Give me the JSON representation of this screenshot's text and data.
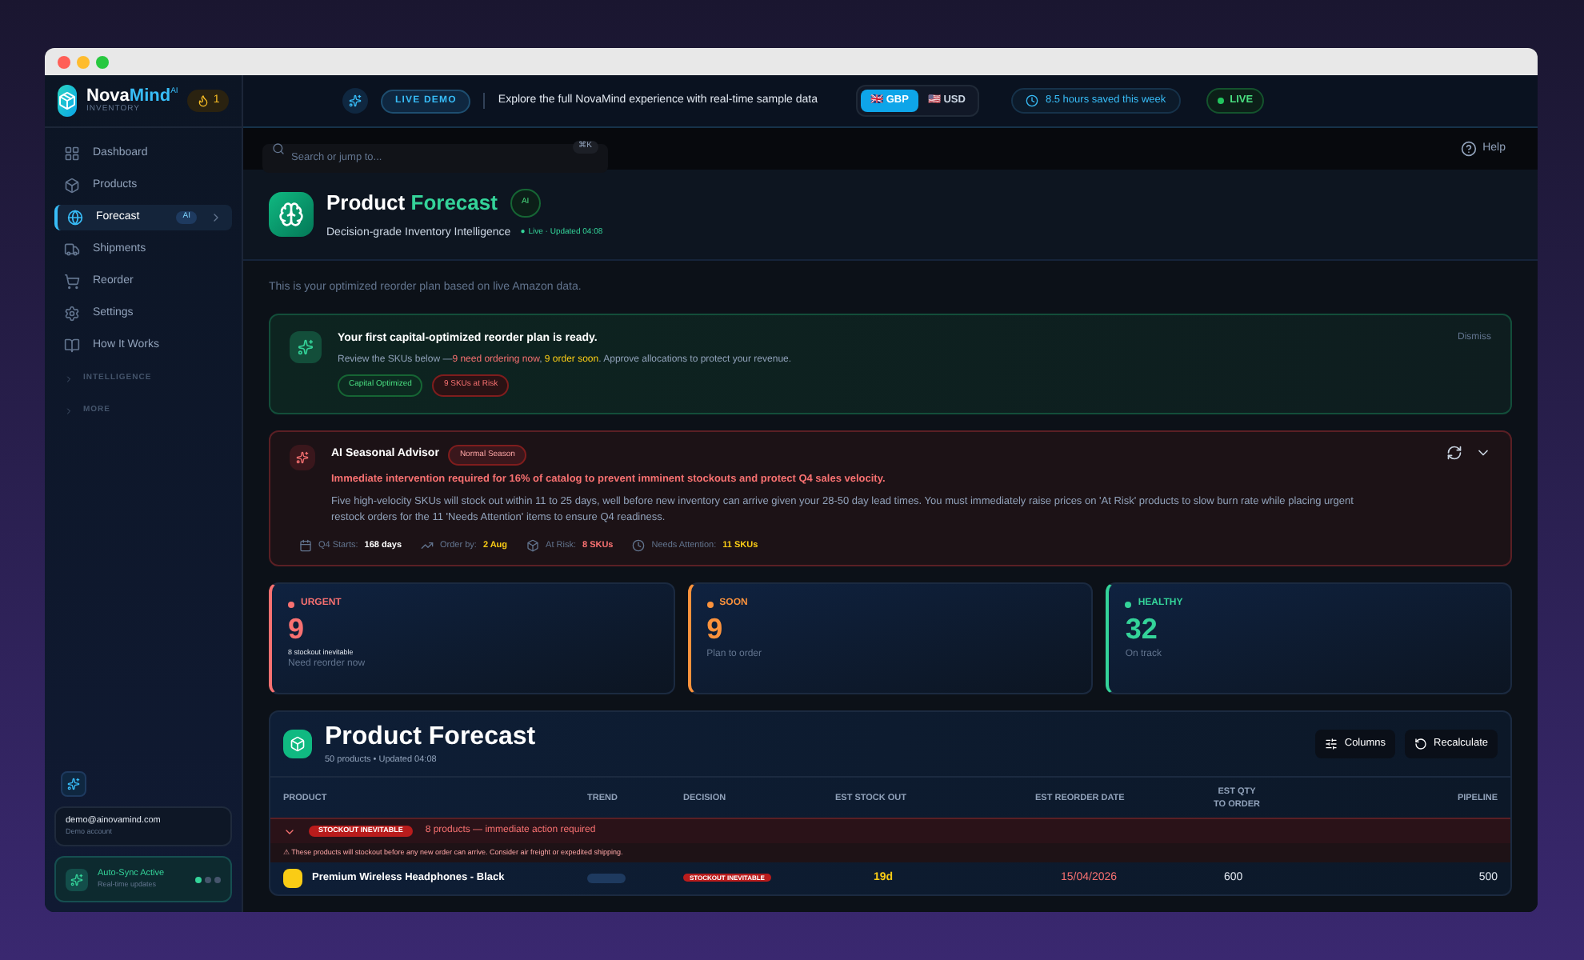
{
  "brand": {
    "name_a": "Nova",
    "name_b": "Mind",
    "sup": "AI",
    "sub": "INVENTORY",
    "streak": "1"
  },
  "sidebar": {
    "items": [
      {
        "label": "Dashboard",
        "selected": false
      },
      {
        "label": "Products",
        "selected": false
      },
      {
        "label": "Forecast",
        "selected": true,
        "badge": "AI"
      },
      {
        "label": "Shipments",
        "selected": false
      },
      {
        "label": "Reorder",
        "selected": false
      },
      {
        "label": "Settings",
        "selected": false
      },
      {
        "label": "How It Works",
        "selected": false
      }
    ],
    "sections": [
      {
        "label": "INTELLIGENCE",
        "expanded": false
      },
      {
        "label": "MORE",
        "expanded": false
      }
    ],
    "account": {
      "email": "demo@ainovamind.com",
      "role": "Demo account"
    },
    "sync": {
      "title": "Auto-Sync Active",
      "subtitle": "Real-time updates"
    }
  },
  "banner": {
    "badge": "LIVE DEMO",
    "text": "Explore the full NovaMind experience with real-time sample data",
    "currencies": [
      {
        "flag": "🇬🇧",
        "code": "GBP",
        "selected": true
      },
      {
        "flag": "🇺🇸",
        "code": "USD",
        "selected": false
      }
    ],
    "saved": "8.5 hours saved this week",
    "live": "LIVE"
  },
  "search": {
    "placeholder": "Search or jump to...",
    "shortcut": "⌘K",
    "help": "Help"
  },
  "header": {
    "title_a": "Product",
    "title_b": "Forecast",
    "ai_badge": "AI",
    "subtitle": "Decision-grade Inventory Intelligence",
    "status_dot": "●",
    "status": "Live · Updated 04:08"
  },
  "intro": "This is your optimized reorder plan based on live Amazon data.",
  "plan_card": {
    "title": "Your first capital-optimized reorder plan is ready.",
    "part_a": "Review the SKUs below —",
    "part_b": "9 need ordering now",
    "part_c": ", ",
    "part_d": "9 order soon",
    "part_e": ". Approve allocations to protect your revenue.",
    "tags": [
      "Capital Optimized",
      "9 SKUs at Risk"
    ],
    "dismiss": "Dismiss"
  },
  "advisor": {
    "title": "AI Seasonal Advisor",
    "season": "Normal Season",
    "headline": "Immediate intervention required for 16% of catalog to prevent imminent stockouts and protect Q4 sales velocity.",
    "body": "Five high-velocity SKUs will stock out within 11 to 25 days, well before new inventory can arrive given your 28-50 day lead times. You must immediately raise prices on 'At Risk' products to slow burn rate while placing urgent restock orders for the 11 'Needs Attention' items to ensure Q4 readiness.",
    "expanded": true,
    "facts": [
      {
        "label": "Q4 Starts:",
        "value": "168 days",
        "color": "#ffffff"
      },
      {
        "label": "Order by:",
        "value": "2 Aug",
        "color": "#facc15"
      },
      {
        "label": "At Risk:",
        "value": "8 SKUs",
        "color": "#f87171"
      },
      {
        "label": "Needs Attention:",
        "value": "11 SKUs",
        "color": "#facc15"
      }
    ]
  },
  "stats": [
    {
      "label": "URGENT",
      "value": "9",
      "note": "8 stockout inevitable",
      "caption": "Need reorder now",
      "color": "#f87171"
    },
    {
      "label": "SOON",
      "value": "9",
      "caption": "Plan to order",
      "color": "#fb923c"
    },
    {
      "label": "HEALTHY",
      "value": "32",
      "caption": "On track",
      "color": "#34d399"
    }
  ],
  "table": {
    "title": "Product Forecast",
    "meta": "50 products • Updated 04:08",
    "buttons": [
      "Columns",
      "Recalculate"
    ],
    "columns": [
      "PRODUCT",
      "TREND",
      "DECISION",
      "EST STOCK OUT",
      "EST REORDER DATE",
      "EST QTY TO ORDER",
      "PIPELINE"
    ],
    "group": {
      "badge": "STOCKOUT INEVITABLE",
      "text": "8 products — immediate action required",
      "warning": "⚠ These products will stockout before any new order can arrive. Consider air freight or expedited shipping.",
      "expanded": true
    },
    "rows": [
      {
        "product": "Premium Wireless Headphones - Black",
        "decision": "STOCKOUT INEVITABLE",
        "stock_out": "19d",
        "reorder_date": "15/04/2026",
        "qty": "600",
        "pipeline": "500"
      }
    ]
  }
}
